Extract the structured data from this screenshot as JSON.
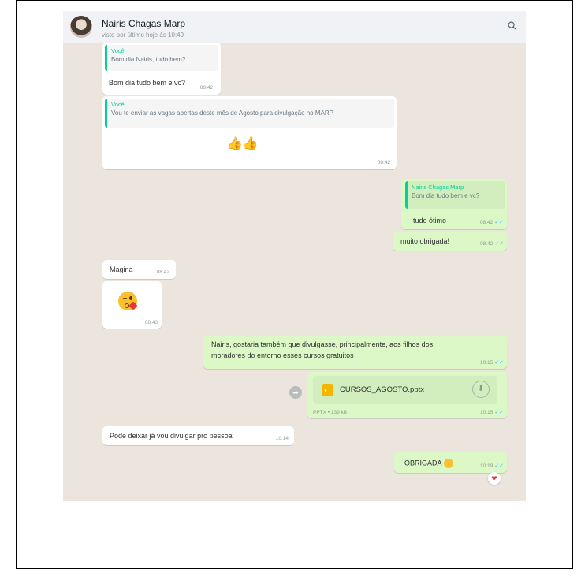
{
  "header": {
    "contact_name": "Nairis Chagas Marp",
    "last_seen": "visto por último hoje às 10:49",
    "search_icon": "search-icon"
  },
  "messages": {
    "m1": {
      "quote_author": "Você",
      "quote_text": "Bom dia Nairis, tudo bem?",
      "text": "Bom dia tudo bem e vc?",
      "time": "08:42"
    },
    "m2": {
      "quote_author": "Você",
      "quote_text": "Vou te enviar as vagas abertas deste mês de Agosto para divulgação no MARP",
      "emoji": "👍👍",
      "time": "08:42"
    },
    "m3": {
      "quote_author": "Nairis Chagas Marp",
      "quote_text": "Bom dia tudo bem e vc?",
      "text": "tudo ótimo",
      "time": "08:42"
    },
    "m4": {
      "text": "muito obrigada!",
      "time": "08:42"
    },
    "m5": {
      "text": "Magina",
      "time": "08:42"
    },
    "m6": {
      "emoji": "kissing-face-with-heart",
      "time": "08:43"
    },
    "m7": {
      "line1": "Nairis, gostaria também que divulgasse, principalmente, aos filhos dos",
      "line2": "moradores do entorno esses cursos gratuitos",
      "time": "10:15"
    },
    "m8": {
      "file_name": "CURSOS_AGOSTO.pptx",
      "file_meta": "PPTX • 139 kB",
      "time": "10:15"
    },
    "m9": {
      "text": "Pode deixar já vou divulgar pro pessoal",
      "time": "10:14"
    },
    "m10": {
      "text": "OBRIGADA",
      "time": "10:19",
      "reaction": "heart"
    }
  },
  "colors": {
    "incoming": "#ffffff",
    "outgoing": "#dcf8c6",
    "wallpaper": "#ebe5de",
    "read_check": "#53bdeb"
  }
}
